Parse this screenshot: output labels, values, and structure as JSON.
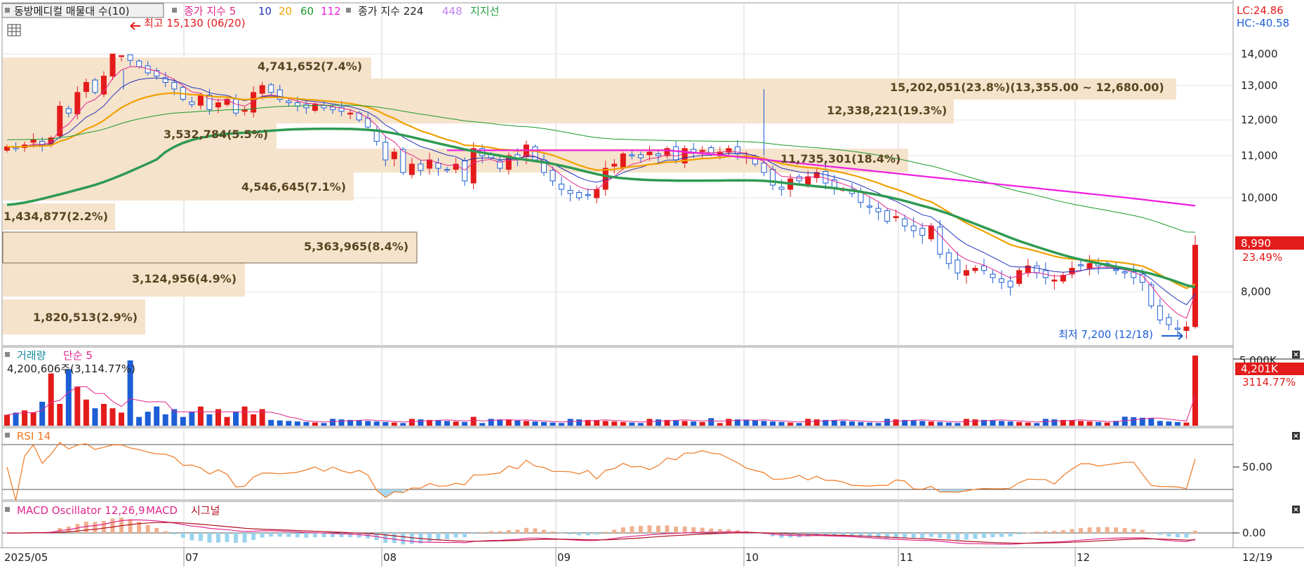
{
  "legend_top": {
    "box_label": "동방메디컬 매물대 수(10)",
    "ma_prefix": "종가 지수 5",
    "ma_10": "10",
    "ma_20": "20",
    "ma_60": "60",
    "ma_112": "112",
    "ma2_prefix": "종가 지수 224",
    "ma_448": "448",
    "support_label": "지지선"
  },
  "colors": {
    "up": "#e31b1b",
    "down": "#1c5ed6",
    "ma5": "#e0288e",
    "ma10": "#2233bb",
    "ma20": "#f0a000",
    "ma60": "#1a9a2a",
    "ma112": "#ee1ee0",
    "ma224": "#2e9a52",
    "ma448": "#c080f0",
    "support": "#22a040",
    "volume_profile": "#f6e3cc",
    "rsi": "#f07820",
    "macd": "#e0288e",
    "signal": "#b01020"
  },
  "header_right": {
    "lc": "LC:24.86",
    "hc": "HC:-40.58"
  },
  "annotations": {
    "high": "최고 15,130 (06/20)",
    "low": "최저 7,200 (12/18)"
  },
  "price_badge": {
    "price": "8,990",
    "change": "23.49%"
  },
  "price_axis": [
    "14,000",
    "13,000",
    "12,000",
    "11,000",
    "10,000",
    "8,000"
  ],
  "volume_profile": [
    {
      "label": "4,741,652(7.4%)",
      "share": 7.4
    },
    {
      "label": "15,202,051(23.8%)(13,355.00 ~ 12,680.00)",
      "share": 23.8
    },
    {
      "label": "12,338,221(19.3%)",
      "share": 19.3
    },
    {
      "label": "3,532,784(5.5%)",
      "share": 5.5
    },
    {
      "label": "11,735,301(18.4%)",
      "share": 18.4
    },
    {
      "label": "4,546,645(7.1%)",
      "share": 7.1
    },
    {
      "label": "1,434,877(2.2%)",
      "share": 2.2
    },
    {
      "label": "5,363,965(8.4%)",
      "share": 8.4
    },
    {
      "label": "3,124,956(4.9%)",
      "share": 4.9
    },
    {
      "label": "1,820,513(2.9%)",
      "share": 2.9
    }
  ],
  "volume_panel": {
    "title": "거래량",
    "ma_label": "단순 5",
    "last_text": "4,200,606주(3,114.77%)",
    "axis_label": "5,000K",
    "badge_value": "4,201K",
    "badge_change": "3114.77%"
  },
  "rsi_panel": {
    "title": "RSI 14",
    "axis_label": "50.00"
  },
  "macd_panel": {
    "title": "MACD Oscillator 12,26,9",
    "macd_label": "MACD",
    "signal_label": "시그널",
    "axis_label": "0.00"
  },
  "date_axis": [
    "2025/05",
    "07",
    "08",
    "09",
    "10",
    "11",
    "12",
    "12/19"
  ],
  "chart_data": {
    "type": "candlestick",
    "series": [
      {
        "name": "동방메디컬",
        "period": "2025/05 - 12/19"
      }
    ],
    "y_ticks": [
      14000,
      13000,
      12000,
      11000,
      10000,
      8000
    ],
    "high": 15130,
    "low": 7200,
    "last_close": 8990,
    "last_change_pct": 23.49,
    "last_volume": 4200606,
    "close": [
      11250,
      11200,
      11300,
      11450,
      11300,
      11500,
      12400,
      12200,
      12800,
      13100,
      12800,
      13300,
      14000,
      14050,
      13800,
      13600,
      13400,
      13300,
      13100,
      12900,
      12600,
      12450,
      12700,
      12300,
      12500,
      12600,
      12200,
      12300,
      12800,
      13000,
      12800,
      12600,
      12500,
      12400,
      12350,
      12450,
      12350,
      12300,
      12250,
      12200,
      12000,
      11800,
      11400,
      10900,
      11100,
      10600,
      10800,
      10650,
      10900,
      10700,
      10650,
      10800,
      10400,
      11200,
      11000,
      10950,
      10700,
      11000,
      10900,
      11300,
      10900,
      10600,
      10400,
      10200,
      10100,
      10000,
      10050,
      10200,
      10700,
      10800,
      11050,
      11000,
      10950,
      11100,
      11000,
      11200,
      10900,
      11200,
      11100,
      11150,
      11050,
      11100,
      11200,
      11050,
      11000,
      10800,
      10600,
      10300,
      10200,
      10450,
      10400,
      10500,
      10600,
      10350,
      10250,
      10200,
      10100,
      9900,
      9800,
      9700,
      9500,
      9600,
      9400,
      9300,
      9200,
      9400,
      8800,
      8600,
      8400,
      8450,
      8500,
      8450,
      8300,
      8200,
      8100,
      8450,
      8550,
      8400,
      8300,
      8250,
      8350,
      8500,
      8550,
      8600,
      8550,
      8550,
      8450,
      8400,
      8300,
      8200,
      7700,
      7400,
      7300,
      7200,
      7250,
      8990
    ],
    "volume_ma": "단순 5",
    "rsi": {
      "period": 14,
      "reference": 50,
      "last": 62
    },
    "macd": {
      "fast": 12,
      "slow": 26,
      "signal": 9,
      "zero_line": 0
    }
  }
}
